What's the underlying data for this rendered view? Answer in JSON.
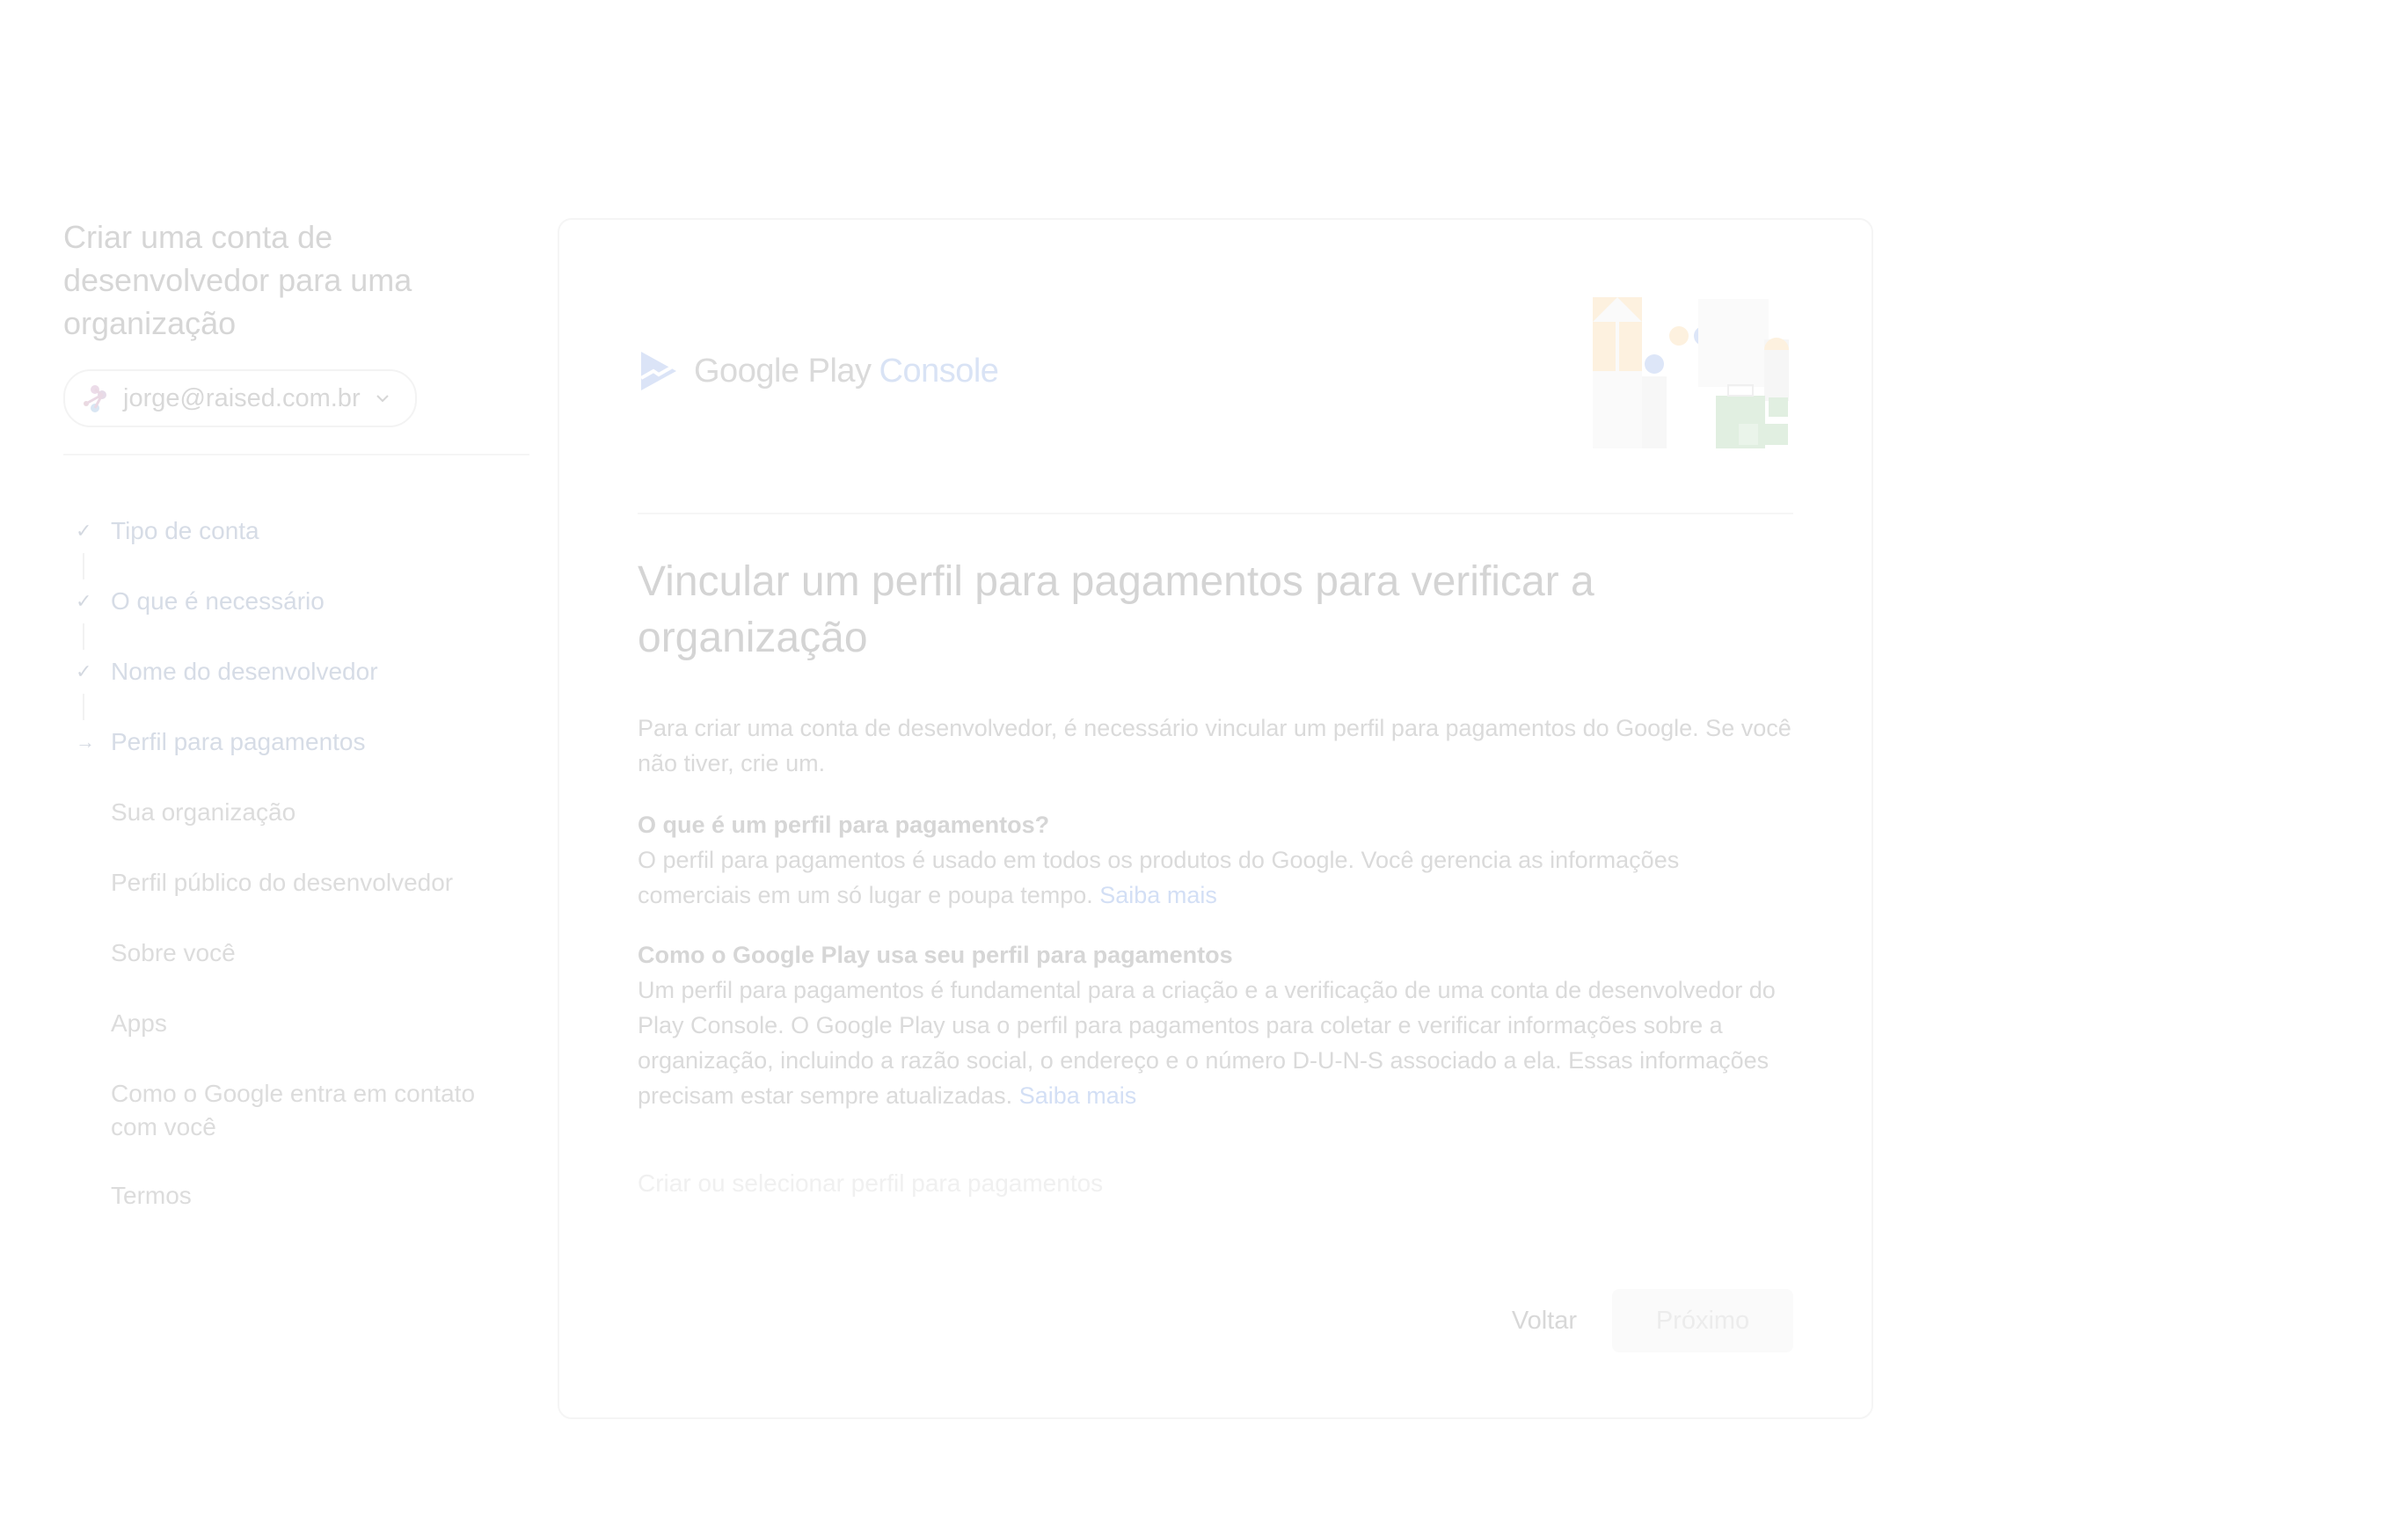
{
  "sidebar": {
    "title": "Criar uma conta de desenvolvedor para uma organização",
    "account": {
      "email": "jorge@raised.com.br",
      "avatar_icon": "avatar-icon",
      "dropdown_icon": "chevron-down-icon"
    },
    "steps": [
      {
        "label": "Tipo de conta",
        "status": "done",
        "icon": "✓"
      },
      {
        "label": "O que é necessário",
        "status": "done",
        "icon": "✓"
      },
      {
        "label": "Nome do desenvolvedor",
        "status": "done",
        "icon": "✓"
      },
      {
        "label": "Perfil para pagamentos",
        "status": "current",
        "icon": "→"
      },
      {
        "label": "Sua organização",
        "status": "pending",
        "icon": ""
      },
      {
        "label": "Perfil público do desenvolvedor",
        "status": "pending",
        "icon": ""
      },
      {
        "label": "Sobre você",
        "status": "pending",
        "icon": ""
      },
      {
        "label": "Apps",
        "status": "pending",
        "icon": ""
      },
      {
        "label": "Como o Google entra em contato com você",
        "status": "pending",
        "icon": ""
      },
      {
        "label": "Termos",
        "status": "pending",
        "icon": ""
      }
    ]
  },
  "card": {
    "logo": {
      "google_play": "Google Play",
      "console": "Console"
    },
    "heading": "Vincular um perfil para pagamentos para verificar a organização",
    "intro": "Para criar uma conta de desenvolvedor, é necessário vincular um perfil para pagamentos do Google. Se você não tiver, crie um.",
    "sections": [
      {
        "title": "O que é um perfil para pagamentos?",
        "body": "O perfil para pagamentos é usado em todos os produtos do Google. Você gerencia as informações comerciais em um só lugar e poupa tempo.",
        "link": "Saiba mais"
      },
      {
        "title": "Como o Google Play usa seu perfil para pagamentos",
        "body": "Um perfil para pagamentos é fundamental para a criação e a verificação de uma conta de desenvolvedor do Play Console. O Google Play usa o perfil para pagamentos para coletar e verificar informações sobre a organização, incluindo a razão social, o endereço e o número D-U-N-S associado a ela. Essas informações precisam estar sempre atualizadas.",
        "link": "Saiba mais"
      }
    ],
    "create_link": "Criar ou selecionar perfil para pagamentos",
    "actions": {
      "back": "Voltar",
      "next": "Próximo"
    }
  },
  "colors": {
    "link": "#d3dff5",
    "accent": "#d9e3f5",
    "text": "#dadada"
  }
}
